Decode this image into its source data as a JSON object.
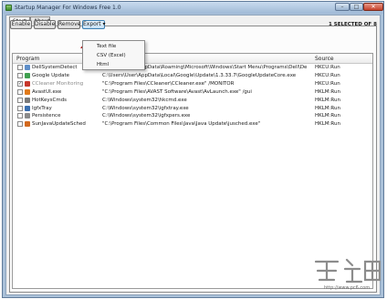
{
  "window": {
    "title": "Startup Manager For Windows Free 1.0",
    "min_glyph": "–",
    "max_glyph": "□",
    "close_glyph": "✕"
  },
  "tabs": [
    {
      "label": "Startup"
    },
    {
      "label": "About"
    }
  ],
  "toolbar": {
    "enable_label": "Enable",
    "disable_label": "Disable",
    "remove_label": "Remove",
    "export_label": "Export ▾"
  },
  "selection_count": "1 SELECTED OF 8",
  "columns": {
    "program": "Program",
    "source": "Source"
  },
  "rows": [
    {
      "checked": false,
      "name": "DellSystemDetect",
      "command": "C:\\Users\\User\\AppData\\Roaming\\Microsoft\\Windows\\Start Menu\\Programs\\Dell\\Dell Sys",
      "source": "HKCU:Run",
      "icon_color": "#5f8fc9"
    },
    {
      "checked": false,
      "name": "Google Update",
      "command": "C:\\Users\\User\\AppData\\Local\\Google\\Update\\1.3.33.7\\GoogleUpdateCore.exe",
      "source": "HKCU:Run",
      "icon_color": "#3f9f4f"
    },
    {
      "checked": true,
      "name": "CCleaner Monitoring",
      "command": "\"C:\\Program Files\\CCleaner\\CCleaner.exe\" /MONITOR",
      "source": "HKCU:Run",
      "icon_color": "#c7372b"
    },
    {
      "checked": false,
      "name": "AvastUI.exe",
      "command": "\"C:\\Program Files\\AVAST Software\\Avast\\AvLaunch.exe\" /gui",
      "source": "HKLM:Run",
      "icon_color": "#e07a1b"
    },
    {
      "checked": false,
      "name": "HotKeysCmds",
      "command": "C:\\Windows\\system32\\hkcmd.exe",
      "source": "HKLM:Run",
      "icon_color": "#7a7a7a"
    },
    {
      "checked": false,
      "name": "IgfxTray",
      "command": "C:\\Windows\\system32\\igfxtray.exe",
      "source": "HKLM:Run",
      "icon_color": "#3a6fb0"
    },
    {
      "checked": false,
      "name": "Persistence",
      "command": "C:\\Windows\\system32\\igfxpers.exe",
      "source": "HKLM:Run",
      "icon_color": "#8a8a8a"
    },
    {
      "checked": false,
      "name": "SunJavaUpdateSched",
      "command": "\"C:\\Program Files\\Common Files\\Java\\Java Update\\jusched.exe\"",
      "source": "HKLM:Run",
      "icon_color": "#d2691e"
    }
  ],
  "export_menu": [
    {
      "label": "Text file"
    },
    {
      "label": "CSV (Excel)"
    },
    {
      "label": "Html"
    }
  ],
  "watermark": {
    "url": "http://www.pc6.com"
  },
  "colors": {
    "arrow": "#b01a1a",
    "export_accent": "#3c7fb1",
    "title_bar": "#a9c0d8"
  }
}
